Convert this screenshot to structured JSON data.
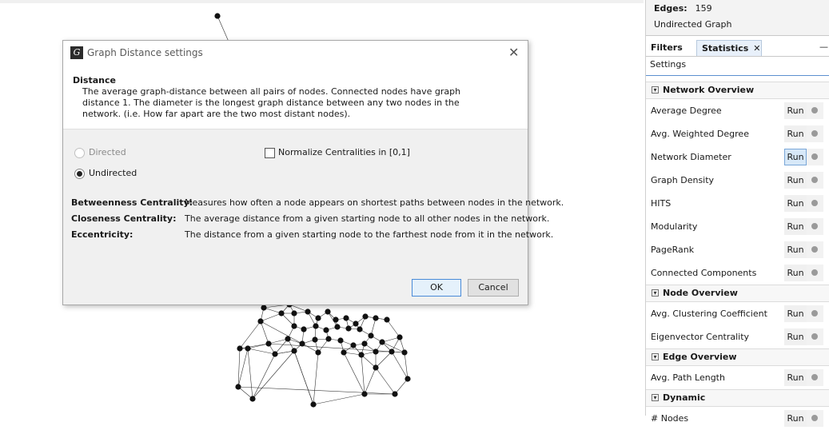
{
  "dialog": {
    "title": "Graph Distance settings",
    "app_icon_glyph": "G",
    "close_glyph": "✕",
    "description_title": "Distance",
    "description_text": "The average graph-distance between all pairs of nodes. Connected nodes have graph distance 1. The diameter is the longest graph distance between any two nodes in the network. (i.e.  How far apart are the two most distant nodes).",
    "directed_label": "Directed",
    "undirected_label": "Undirected",
    "normalize_label": "Normalize Centralities in [0,1]",
    "definitions": [
      {
        "term": "Betweenness Centrality:",
        "text": "Measures how often a node appears on shortest paths between nodes in the network."
      },
      {
        "term": "Closeness Centrality:",
        "text": "The average distance from a given starting node to all other nodes in the network."
      },
      {
        "term": "Eccentricity:",
        "text": "The distance from a given starting node to the farthest node from it in the network."
      }
    ],
    "ok_label": "OK",
    "cancel_label": "Cancel"
  },
  "graph_info": {
    "edges_label": "Edges:",
    "edges_value": "159",
    "graph_type": "Undirected Graph"
  },
  "tabs": {
    "filters": "Filters",
    "statistics": "Statistics",
    "close_glyph": "✕",
    "minimize_glyph": "—"
  },
  "settings_label": "Settings",
  "run_label": "Run",
  "sections": [
    {
      "title": "Network Overview",
      "items": [
        "Average Degree",
        "Avg. Weighted Degree",
        "Network Diameter",
        "Graph Density",
        "HITS",
        "Modularity",
        "PageRank",
        "Connected Components"
      ]
    },
    {
      "title": "Node Overview",
      "items": [
        "Avg. Clustering Coefficient",
        "Eigenvector Centrality"
      ]
    },
    {
      "title": "Edge Overview",
      "items": [
        "Avg. Path Length"
      ]
    },
    {
      "title": "Dynamic",
      "items": [
        "# Nodes"
      ]
    }
  ],
  "colors": {
    "accent": "#5c8fd0",
    "node": "#111111",
    "status_dot": "#9a9a9a"
  }
}
